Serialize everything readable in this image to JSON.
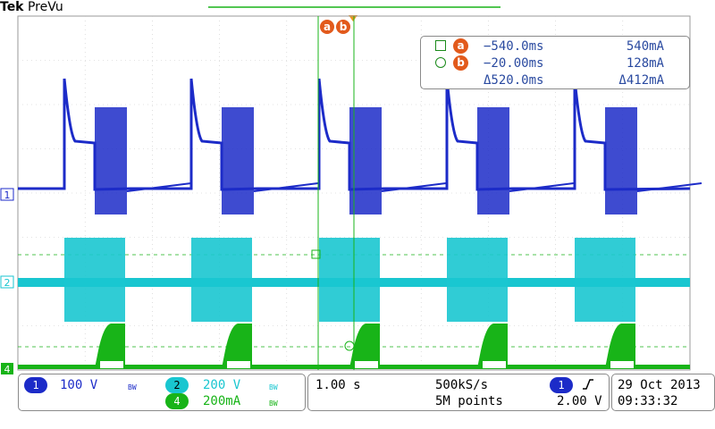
{
  "header": {
    "brand": "Tek",
    "mode": "PreVu"
  },
  "cursors": {
    "a_label": "a",
    "b_label": "b"
  },
  "readout": {
    "a": {
      "time": "−540.0ms",
      "value": "540mA"
    },
    "b": {
      "time": "−20.00ms",
      "value": "128mA"
    },
    "delta": {
      "time": "Δ520.0ms",
      "value": "Δ412mA"
    }
  },
  "channels": [
    {
      "num": "1",
      "scale": "100 V",
      "bw": "BW",
      "color": "#1c2bc8"
    },
    {
      "num": "2",
      "scale": "200 V",
      "bw": "BW",
      "color": "#19c6d0"
    },
    {
      "num": "4",
      "scale": "200mA",
      "bw": "BW",
      "color": "#18b418"
    }
  ],
  "timebase": {
    "scale": "1.00 s",
    "rate": "500kS/s",
    "points": "5M points"
  },
  "trigger": {
    "source": "1",
    "level": "2.00 V",
    "slope": "rising-edge-icon"
  },
  "datetime": {
    "date": "29 Oct  2013",
    "time": "09:33:32"
  }
}
